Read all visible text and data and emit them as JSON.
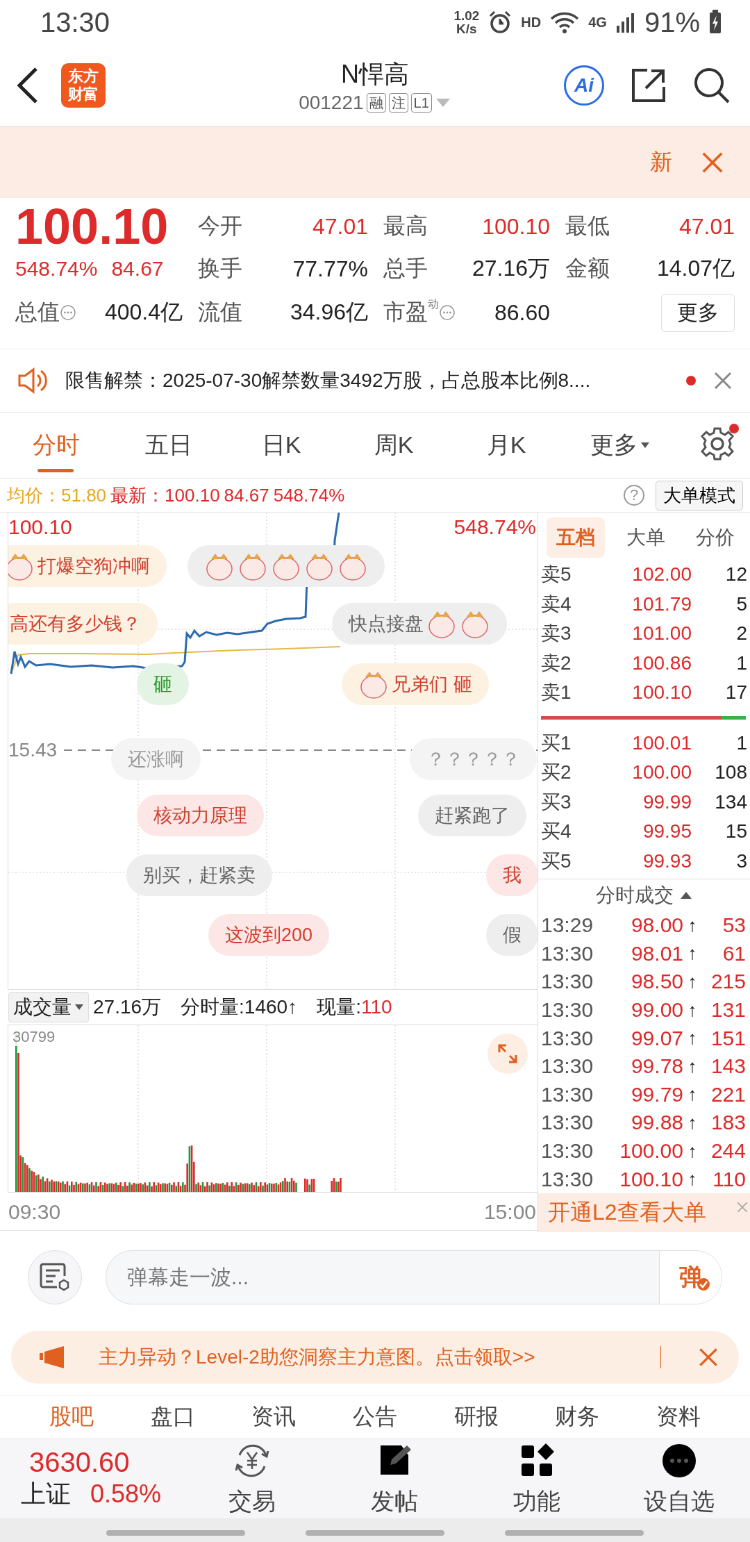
{
  "status_bar": {
    "time": "13:30",
    "speed_value": "1.02",
    "speed_unit": "K/s",
    "hd": "HD",
    "network": "4G",
    "battery": "91%"
  },
  "header": {
    "logo_lines": [
      "东方",
      "财富"
    ],
    "title": "N悍高",
    "code": "001221",
    "badges": [
      "融",
      "注",
      "L1"
    ],
    "ai_label": "Ai"
  },
  "banner": {
    "tag": "新"
  },
  "quote": {
    "price": "100.10",
    "change_pct": "548.74%",
    "change": "84.67",
    "more": "更多",
    "stats": [
      {
        "label": "今开",
        "value": "47.01",
        "color": "#dd2a2a",
        "info": false
      },
      {
        "label": "最高",
        "value": "100.10",
        "color": "#dd2a2a",
        "info": false
      },
      {
        "label": "最低",
        "value": "47.01",
        "color": "#dd2a2a",
        "info": false
      },
      {
        "label": "换手",
        "value": "77.77%",
        "color": "#222222",
        "info": false
      },
      {
        "label": "总手",
        "value": "27.16万",
        "color": "#222222",
        "info": false
      },
      {
        "label": "金额",
        "value": "14.07亿",
        "color": "#222222",
        "info": false
      },
      {
        "label": "总值",
        "value": "400.4亿",
        "color": "#222222",
        "info": true
      },
      {
        "label": "流值",
        "value": "34.96亿",
        "color": "#222222",
        "info": false
      },
      {
        "label": "市盈",
        "sup": "动",
        "value": "86.60",
        "color": "#222222",
        "info": true
      }
    ]
  },
  "notice": {
    "text": "限售解禁：2025-07-30解禁数量3492万股，占总股本比例8....",
    "unread": true
  },
  "chart_tabs": [
    {
      "label": "分时",
      "selected": true
    },
    {
      "label": "五日",
      "selected": false
    },
    {
      "label": "日K",
      "selected": false
    },
    {
      "label": "周K",
      "selected": false
    },
    {
      "label": "月K",
      "selected": false
    }
  ],
  "more_tab": "更多",
  "settings_badge": true,
  "info_line": {
    "avg_label": "均价：",
    "avg": "51.80",
    "latest_label": "最新：",
    "latest": "100.10",
    "change": "84.67",
    "change_pct": "548.74%",
    "help": "?",
    "mode_button": "大单模式"
  },
  "price_chart": {
    "top_price": "100.10",
    "top_pct": "548.74%",
    "base_price": "15.43"
  },
  "danmaku": [
    {
      "text": "打爆空狗冲啊",
      "kind": "warm",
      "stickers": [
        {
          "kind": "before"
        }
      ]
    },
    {
      "kind": "plain",
      "stickers": [
        {
          "kind": "only"
        },
        {
          "kind": "only"
        },
        {
          "kind": "only"
        },
        {
          "kind": "only"
        },
        {
          "kind": "only"
        }
      ]
    },
    {
      "text": "高还有多少钱？",
      "kind": "warm"
    },
    {
      "text": "快点接盘",
      "kind": "plain",
      "stickers": [
        {
          "kind": "after"
        },
        {
          "kind": "after"
        }
      ]
    },
    {
      "text": "砸",
      "kind": "green"
    },
    {
      "text": "兄弟们 砸",
      "kind": "warm",
      "stickers": [
        {
          "kind": "before"
        }
      ]
    },
    {
      "text": "还涨啊",
      "kind": "faint"
    },
    {
      "text": "？？？？？",
      "kind": "faint"
    },
    {
      "text": "核动力原理",
      "kind": "red"
    },
    {
      "text": "赶紧跑了",
      "kind": "plain"
    },
    {
      "text": "别买，赶紧卖",
      "kind": "plain"
    },
    {
      "text": "我",
      "kind": "red"
    },
    {
      "text": "这波到200",
      "kind": "red"
    },
    {
      "text": "假",
      "kind": "plain"
    }
  ],
  "volume_bar": {
    "selector": "成交量",
    "total": "27.16万",
    "minute_volume": "分时量:1460↑",
    "current_label": "现量:",
    "current": "110",
    "max_label": "30799",
    "start_time": "09:30",
    "end_time": "15:00"
  },
  "order_tabs": [
    {
      "label": "五档",
      "selected": true
    },
    {
      "label": "大单",
      "selected": false
    },
    {
      "label": "分价",
      "selected": false
    }
  ],
  "asks": [
    {
      "label": "卖5",
      "price": "102.00",
      "volume": "12"
    },
    {
      "label": "卖4",
      "price": "101.79",
      "volume": "5"
    },
    {
      "label": "卖3",
      "price": "101.00",
      "volume": "2"
    },
    {
      "label": "卖2",
      "price": "100.86",
      "volume": "1"
    },
    {
      "label": "卖1",
      "price": "100.10",
      "volume": "17"
    }
  ],
  "ratio_bar": {
    "level": 0.88
  },
  "bids": [
    {
      "label": "买1",
      "price": "100.01",
      "volume": "1"
    },
    {
      "label": "买2",
      "price": "100.00",
      "volume": "108"
    },
    {
      "label": "买3",
      "price": "99.99",
      "volume": "134"
    },
    {
      "label": "买4",
      "price": "99.95",
      "volume": "15"
    },
    {
      "label": "买5",
      "price": "99.93",
      "volume": "3"
    }
  ],
  "trades_title": "分时成交",
  "trades": [
    {
      "time": "13:29",
      "price": "98.00",
      "arrow": "↑",
      "volume": "53"
    },
    {
      "time": "13:30",
      "price": "98.01",
      "arrow": "↑",
      "volume": "61"
    },
    {
      "time": "13:30",
      "price": "98.50",
      "arrow": "↑",
      "volume": "215"
    },
    {
      "time": "13:30",
      "price": "99.00",
      "arrow": "↑",
      "volume": "131"
    },
    {
      "time": "13:30",
      "price": "99.07",
      "arrow": "↑",
      "volume": "151"
    },
    {
      "time": "13:30",
      "price": "99.78",
      "arrow": "↑",
      "volume": "143"
    },
    {
      "time": "13:30",
      "price": "99.79",
      "arrow": "↑",
      "volume": "221"
    },
    {
      "time": "13:30",
      "price": "99.88",
      "arrow": "↑",
      "volume": "183"
    },
    {
      "time": "13:30",
      "price": "100.00",
      "arrow": "↑",
      "volume": "244"
    },
    {
      "time": "13:30",
      "price": "100.10",
      "arrow": "↑",
      "volume": "110"
    }
  ],
  "l2_banner": "开通L2查看大单",
  "comment": {
    "placeholder": "弹幕走一波...",
    "send": "弹"
  },
  "promo": "主力异动？Level-2助您洞察主力意图。点击领取>>",
  "section_tabs": [
    {
      "label": "股吧",
      "selected": true
    },
    {
      "label": "盘口",
      "selected": false
    },
    {
      "label": "资讯",
      "selected": false
    },
    {
      "label": "公告",
      "selected": false
    },
    {
      "label": "研报",
      "selected": false
    },
    {
      "label": "财务",
      "selected": false
    },
    {
      "label": "资料",
      "selected": false
    }
  ],
  "bottom_nav": {
    "index_value": "3630.60",
    "index_name": "上证",
    "index_change": "0.58%",
    "items": [
      {
        "kind": "trade",
        "label": "交易"
      },
      {
        "kind": "post",
        "label": "发帖"
      },
      {
        "kind": "apps",
        "label": "功能"
      },
      {
        "kind": "more",
        "label": "设自选"
      }
    ]
  }
}
